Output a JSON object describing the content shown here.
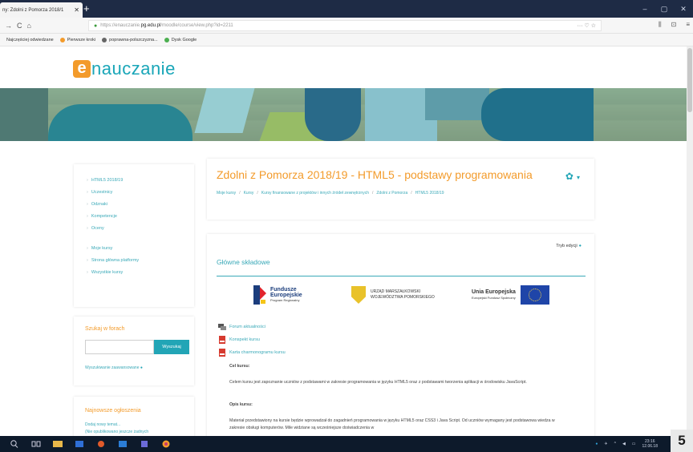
{
  "browser": {
    "tab_title": "ny: Zdolni z Pomorza 2018/1",
    "tab_close": "✕",
    "new_tab": "+",
    "window_controls": [
      "–",
      "▢",
      "✕"
    ],
    "url_prefix": "https://enauczanie.",
    "url_host": "pg.edu.pl",
    "url_rest": "/moodle/course/view.php?id=2211",
    "url_actions": "··· ♡ ☆",
    "nav_icons": [
      "→",
      "C",
      "⌂"
    ],
    "right_icons": [
      "⫼",
      "⊡",
      "≡"
    ]
  },
  "bookmarks": [
    {
      "label": "Najczęściej odwiedzane",
      "color": "#e6e6e6"
    },
    {
      "label": "Pierwsze kroki",
      "color": "#f39b2b"
    },
    {
      "label": "poprawna-polszczyzna...",
      "color": "#666"
    },
    {
      "label": "Dysk Google",
      "color": "#4caf50"
    }
  ],
  "logo": {
    "letter": "e",
    "text": "nauczanie"
  },
  "left_nav": {
    "items": [
      "HTML5 2018/19",
      "Uczestnicy",
      "Odznaki",
      "Kompetencje",
      "Oceny"
    ],
    "items2": [
      "Moje kursy",
      "Strona główna platformy",
      "Wszystkie kursy"
    ]
  },
  "forum_search": {
    "title": "Szukaj w forach",
    "button": "Wyszukaj",
    "advanced": "Wyszukiwanie zaawansowane"
  },
  "news": {
    "title": "Najnowsze ogłoszenia",
    "line1": "Dodaj nowy temat...",
    "line2": "(Nie opublikowano jeszcze żadnych"
  },
  "course": {
    "title": "Zdolni z Pomorza 2018/19 - HTML5 - podstawy programowania",
    "gear": "✿",
    "breadcrumb": [
      "Moje kursy",
      "Kursy",
      "Kursy finansowane z projektów i innych źródeł zewnętrznych",
      "Zdolni z Pomorza",
      "HTML5 2018/19"
    ]
  },
  "content": {
    "edit_link": "Tryb edycji",
    "section_title": "Główne składowe",
    "logos": {
      "fundusze_1": "Fundusze",
      "fundusze_2": "Europejskie",
      "fundusze_sub": "Program Regionalny",
      "urzad_1": "URZĄD MARSZAŁKOWSKI",
      "urzad_2": "WOJEWÓDZTWA POMORSKIEGO",
      "ue_1": "Unia Europejska",
      "ue_sub": "Europejski Fundusz Społeczny"
    },
    "resources": [
      "Forum aktualności",
      "Konspekt kursu",
      "Karta charmonogramu kursu"
    ],
    "goal_title": "Cel kursu:",
    "goal_text": "Celem kursu jest zapoznanie uczniów z podstawami w zakresie programowania w języku HTML5 oraz z podstawami tworzenia aplikacji w środowisku JavaScript.",
    "desc_title": "Opis kursu:",
    "desc_text": "Materiał przedstawiony na kursie będzie wprowadzał do zagadnień programowania w języku HTML5 oraz CSS3 i Java Script. Od uczniów wymagany jest podstawowa wiedza w zakresie obsługi komputerów. Mile widziane są wcześniejsze doświadczenia w"
  },
  "taskbar": {
    "clock": "23:16",
    "date": "12.06.18"
  },
  "page_number": "5",
  "colors": {
    "accent": "#22a5b6",
    "title": "#f39b2b",
    "taskbar": "#0d1a2b",
    "tabbar": "#1e2b45"
  }
}
